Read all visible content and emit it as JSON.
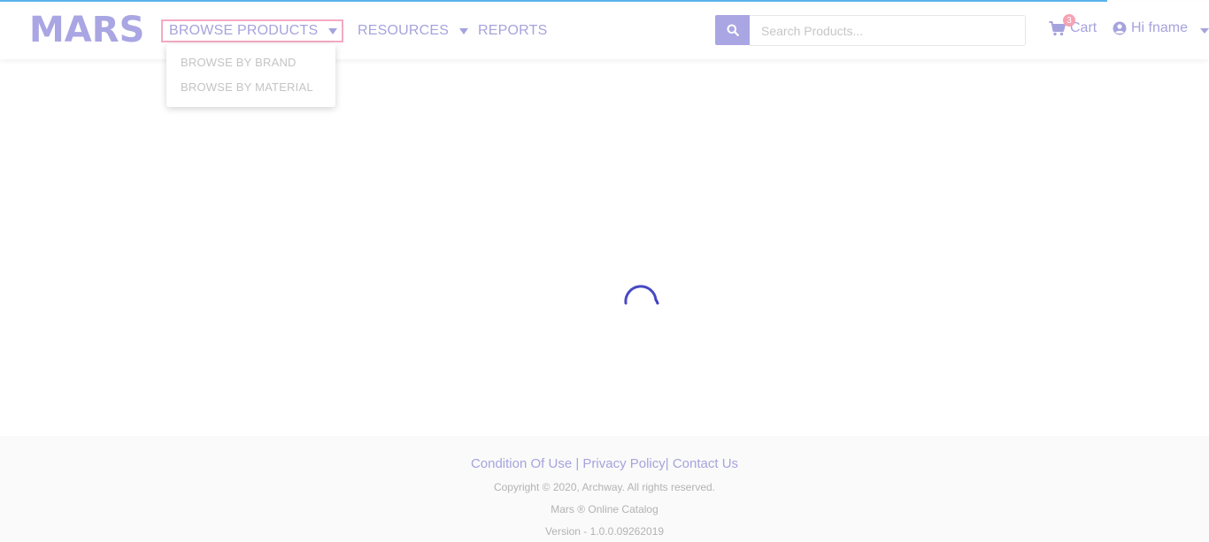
{
  "brand": {
    "logo_text": "MARS",
    "logo_color": "#a9a6e3"
  },
  "nav": {
    "browse_products": "BROWSE PRODUCTS",
    "resources": "RESOURCES",
    "reports": "REPORTS",
    "browse_dropdown": {
      "items": [
        {
          "label": "BROWSE BY BRAND"
        },
        {
          "label": "BROWSE BY MATERIAL"
        }
      ]
    }
  },
  "search": {
    "placeholder": "Search Products...",
    "value": "",
    "icon": "search-icon"
  },
  "cart": {
    "label": "Cart",
    "count": "3",
    "icon": "shopping-cart-icon"
  },
  "user": {
    "greeting": "Hi fname",
    "icon": "user-circle-icon"
  },
  "main": {
    "loading": true,
    "spinner_color": "#3f3fc0"
  },
  "footer": {
    "links": [
      "Condition Of Use",
      "Privacy Policy",
      "Contact Us"
    ],
    "separators": [
      " | ",
      "| "
    ],
    "copyright": "Copyright © 2020, Archway. All rights reserved.",
    "product": "Mars ® Online Catalog",
    "version": "Version - 1.0.0.09262019"
  },
  "colors": {
    "accent": "#a5a3dd",
    "focus_outline": "#f3a9c3",
    "badge": "#f4a3b3",
    "progress": "#5bb3ee"
  }
}
